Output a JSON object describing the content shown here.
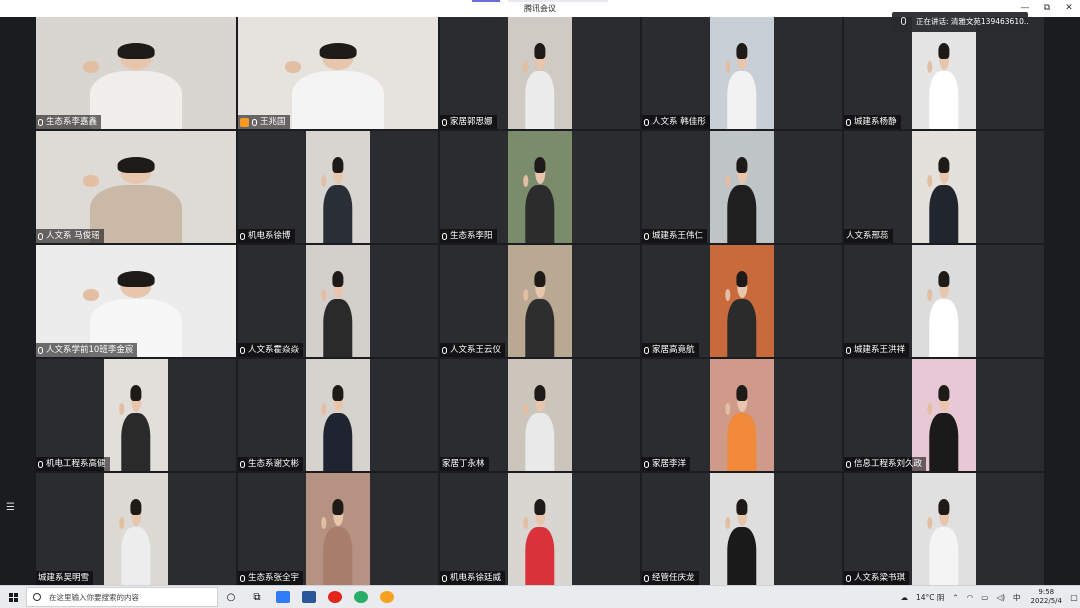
{
  "window": {
    "title": "腾讯会议",
    "minimize": "—",
    "restore": "⧉",
    "close": "✕"
  },
  "speaking": {
    "label": "正在讲话: 清雅文苑13946361​0..."
  },
  "tiles": [
    {
      "name": "生态系李嘉鑫",
      "mic": true,
      "wide": true,
      "bg": "#d9d6d2",
      "shirt": "#f0eeea"
    },
    {
      "name": "王兆国",
      "mic": true,
      "host": true,
      "wide": true,
      "bg": "#e6e3df",
      "shirt": "#f4f4f4"
    },
    {
      "name": "家居郭思娜",
      "mic": true,
      "bg": "#cfcac3",
      "shirt": "#ececec"
    },
    {
      "name": "人文系  韩佳彤",
      "mic": true,
      "bg": "#c9cfd6",
      "shirt": "#f2f2f2"
    },
    {
      "name": "城建系杨静",
      "mic": true,
      "bg": "#e5e5e5",
      "shirt": "#ffffff"
    },
    {
      "name": "人文系 马俊瑶",
      "mic": true,
      "wide": true,
      "bg": "#dedad5",
      "shirt": "#cbb9a8"
    },
    {
      "name": "机电系徐博",
      "mic": true,
      "bg": "#d8d5d1",
      "shirt": "#2a2e36"
    },
    {
      "name": "生态系李阳",
      "mic": true,
      "bg": "#7b8c6c",
      "shirt": "#2c2c2c"
    },
    {
      "name": "城建系王伟仁",
      "mic": true,
      "bg": "#bfc4c6",
      "shirt": "#1f1f1f"
    },
    {
      "name": "人文系邢蕊",
      "mic": false,
      "bg": "#e4e1dc",
      "shirt": "#20252e"
    },
    {
      "name": "人文系学前10班李金宸",
      "mic": true,
      "wide": true,
      "bg": "#ececec",
      "shirt": "#f7f7f7"
    },
    {
      "name": "人文系霍焱焱",
      "mic": true,
      "bg": "#d3cfcb",
      "shirt": "#2a2a2a"
    },
    {
      "name": "人文系王云仪",
      "mic": true,
      "bg": "#b9a892",
      "shirt": "#2e2e2e"
    },
    {
      "name": "家居高竟航",
      "mic": true,
      "bg": "#c96a3d",
      "shirt": "#2b2b2b"
    },
    {
      "name": "城建系王洪祥",
      "mic": true,
      "bg": "#dcdcdc",
      "shirt": "#ffffff"
    },
    {
      "name": "机电工程系高健",
      "mic": true,
      "bg": "#e2dfdb",
      "shirt": "#2a2a2a"
    },
    {
      "name": "生态系谢文彬",
      "mic": true,
      "bg": "#d6d3cf",
      "shirt": "#1f2430"
    },
    {
      "name": "家居丁永林",
      "mic": false,
      "bg": "#cbc5bc",
      "shirt": "#e9e9e9"
    },
    {
      "name": "家居李洋",
      "mic": true,
      "bg": "#cf9a8a",
      "shirt": "#f08a3a"
    },
    {
      "name": "信息工程系刘久政",
      "mic": true,
      "bg": "#e8c8d4",
      "shirt": "#1a1a1a"
    },
    {
      "name": "城建系吴明雪",
      "mic": false,
      "bg": "#dddad6",
      "shirt": "#ededed"
    },
    {
      "name": "生态系张全宇",
      "mic": true,
      "bg": "#b69282",
      "shirt": "#a87d6a"
    },
    {
      "name": "机电系徐廷威",
      "mic": true,
      "bg": "#d9d6d2",
      "shirt": "#d9323a"
    },
    {
      "name": "经管任庆龙",
      "mic": true,
      "bg": "#dedede",
      "shirt": "#1a1a1a"
    },
    {
      "name": "人文系梁书琪",
      "mic": true,
      "bg": "#e0e0e0",
      "shirt": "#f4f4f4"
    }
  ],
  "taskbar": {
    "search_placeholder": "在这里输入你要搜索的内容",
    "weather": "14°C 阴",
    "ime": "中",
    "time": "9:58",
    "date": "2022/5/4"
  }
}
